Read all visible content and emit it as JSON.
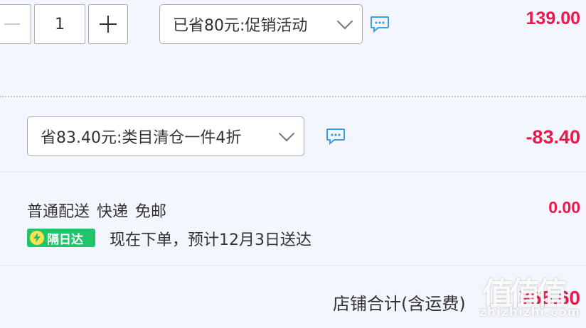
{
  "item": {
    "quantity": "1",
    "promo": {
      "label": "已省80元:促销活动",
      "price": "139.00"
    }
  },
  "discount": {
    "label": "省83.40元:类目清仓一件4折",
    "amount": "-83.40"
  },
  "shipping": {
    "method_parts": [
      "普通配送",
      "快递",
      "免邮"
    ],
    "cost": "0.00",
    "badge": "隔日达",
    "eta": "现在下单，预计12月3日送达"
  },
  "total": {
    "label": "店铺合计(含运费)",
    "amount": "¥55.60"
  },
  "watermark": {
    "logo": "值值值",
    "text": "zhizhizhi.com"
  },
  "colors": {
    "price_red": "#f0154a",
    "badge_green": "#22c46b",
    "chat_blue": "#3a9fe8",
    "background": "#f3f7fd"
  },
  "icons": {
    "minus": "minus-icon",
    "plus": "plus-icon",
    "dropdown": "chevron-down-icon",
    "chat": "chat-bubble-icon",
    "lightning": "lightning-icon"
  }
}
